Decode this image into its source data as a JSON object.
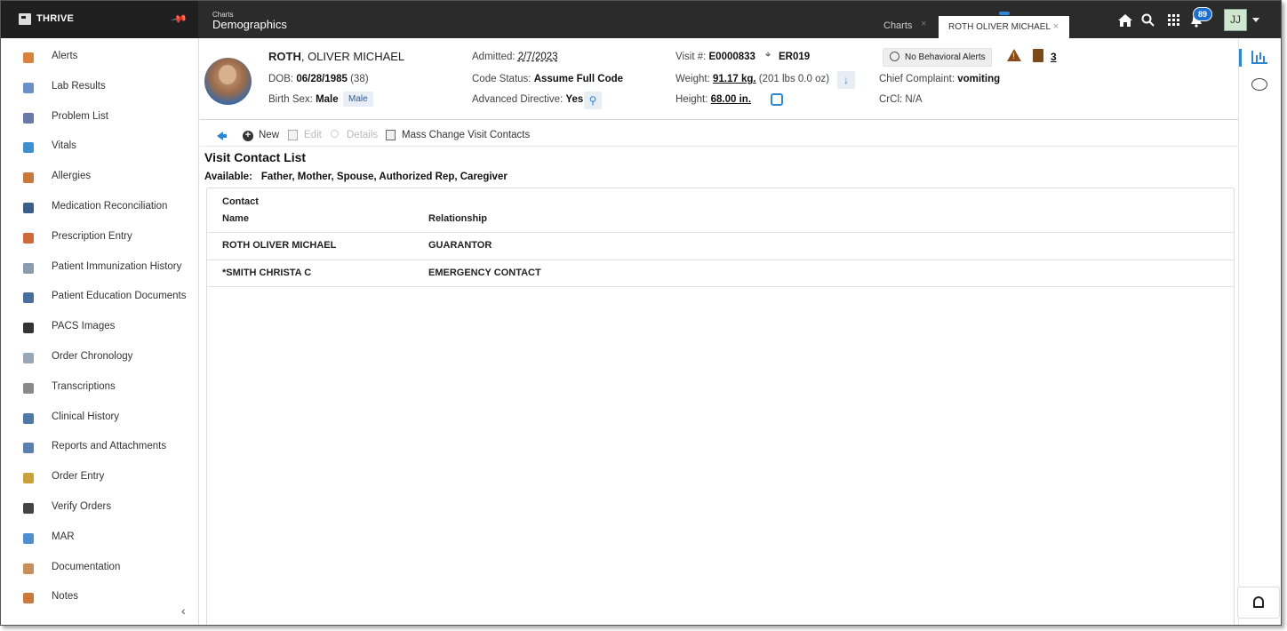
{
  "brand": {
    "name": "THRIVE"
  },
  "breadcrumb": {
    "parent": "Charts",
    "current": "Demographics"
  },
  "tabs": {
    "charts": "Charts",
    "patient_tab": "ROTH OLIVER MICHAEL",
    "close_glyph": "×"
  },
  "topbar": {
    "notification_count": "89",
    "user_initials": "JJ"
  },
  "sidebar": {
    "items": [
      {
        "label": "Alerts",
        "color": "#d9823b"
      },
      {
        "label": "Lab Results",
        "color": "#6a8fc9"
      },
      {
        "label": "Problem List",
        "color": "#6a7aa8"
      },
      {
        "label": "Vitals",
        "color": "#3e8fcf"
      },
      {
        "label": "Allergies",
        "color": "#c9793b"
      },
      {
        "label": "Medication Reconciliation",
        "color": "#3b5f8a"
      },
      {
        "label": "Prescription Entry",
        "color": "#d06a3b"
      },
      {
        "label": "Patient Immunization History",
        "color": "#8a9bb0"
      },
      {
        "label": "Patient Education Documents",
        "color": "#4a6f9c"
      },
      {
        "label": "PACS Images",
        "color": "#333333"
      },
      {
        "label": "Order Chronology",
        "color": "#9aa5b5"
      },
      {
        "label": "Transcriptions",
        "color": "#8a8a8a"
      },
      {
        "label": "Clinical History",
        "color": "#4f77a8"
      },
      {
        "label": "Reports and Attachments",
        "color": "#5b7fb0"
      },
      {
        "label": "Order Entry",
        "color": "#c9a23b"
      },
      {
        "label": "Verify Orders",
        "color": "#444444"
      },
      {
        "label": "MAR",
        "color": "#4f8fcf"
      },
      {
        "label": "Documentation",
        "color": "#c98f5b"
      },
      {
        "label": "Notes",
        "color": "#c97a3b"
      }
    ],
    "collapse_glyph": "‹"
  },
  "patient": {
    "last_name": "ROTH",
    "first_names": ", OLIVER MICHAEL",
    "dob_label": "DOB:",
    "dob": "06/28/1985",
    "age": "(38)",
    "birth_sex_label": "Birth Sex:",
    "birth_sex": "Male",
    "gender_chip": "Male",
    "admitted_label": "Admitted:",
    "admitted": "2/7/2023",
    "code_status_label": "Code Status:",
    "code_status": "Assume Full Code",
    "adv_dir_label": "Advanced Directive:",
    "adv_dir": "Yes",
    "visit_label": "Visit #:",
    "visit": "E0000833",
    "location": "ER019",
    "weight_label": "Weight:",
    "weight": "91.17 kg.",
    "weight_lbs": "(201 lbs 0.0 oz)",
    "height_label": "Height:",
    "height": "68.00 in.",
    "behavioral_alerts": "No Behavioral Alerts",
    "complaint_label": "Chief Complaint:",
    "complaint": "vomiting",
    "crcl_label": "CrCl:",
    "crcl": "N/A",
    "alert_count": "3"
  },
  "toolbar": {
    "new": "New",
    "edit": "Edit",
    "details": "Details",
    "mass_change": "Mass Change Visit Contacts"
  },
  "content": {
    "title": "Visit Contact List",
    "available_label": "Available:",
    "available": "Father, Mother, Spouse, Authorized Rep, Caregiver",
    "columns": {
      "name_line1": "Contact",
      "name_line2": "Name",
      "relationship": "Relationship"
    },
    "rows": [
      {
        "name": "ROTH OLIVER MICHAEL",
        "relationship": "GUARANTOR"
      },
      {
        "name": "*SMITH CHRISTA C",
        "relationship": "EMERGENCY CONTACT"
      }
    ]
  }
}
